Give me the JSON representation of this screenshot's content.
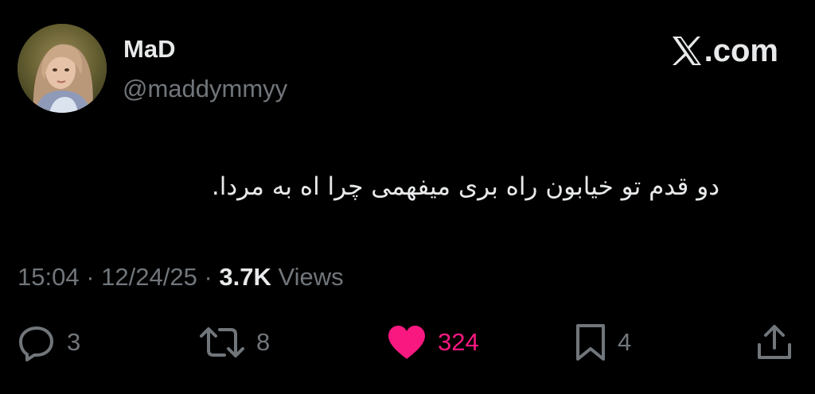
{
  "brand": {
    "label": ".com",
    "icon": "x-logo-icon"
  },
  "author": {
    "display_name": "MaD",
    "handle": "@maddymmyy",
    "avatar": "avatar-photo"
  },
  "tweet": {
    "text": "دو قدم تو خیابون راه بری میفهمی چرا اه به مردا."
  },
  "meta": {
    "time": "15:04",
    "separator": "·",
    "date": "12/24/25",
    "views_count": "3.7K",
    "views_label": "Views"
  },
  "actions": {
    "reply": {
      "icon": "reply-icon",
      "count": "3"
    },
    "retweet": {
      "icon": "retweet-icon",
      "count": "8"
    },
    "like": {
      "icon": "heart-icon",
      "count": "324",
      "active": true
    },
    "bookmark": {
      "icon": "bookmark-icon",
      "count": "4"
    },
    "share": {
      "icon": "share-icon"
    }
  },
  "colors": {
    "background": "#000000",
    "text_primary": "#e7e9ea",
    "text_secondary": "#71767b",
    "like_accent": "#f91880"
  }
}
